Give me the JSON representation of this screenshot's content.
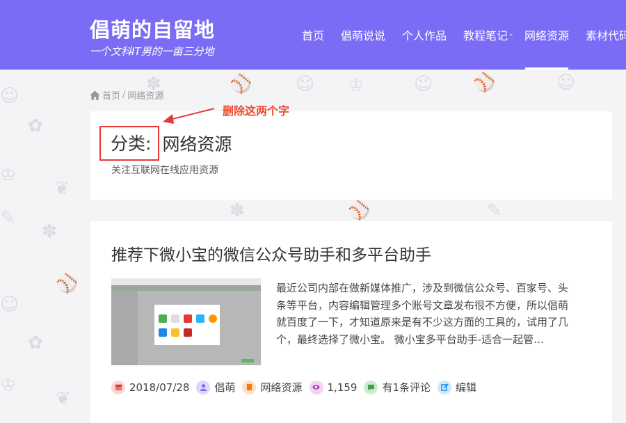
{
  "header": {
    "site_title": "倡萌的自留地",
    "site_subtitle": "一个文科IT男的一亩三分地",
    "background_color": "#7b6cf6"
  },
  "nav": {
    "items": [
      {
        "label": "首页"
      },
      {
        "label": "倡萌说说"
      },
      {
        "label": "个人作品"
      },
      {
        "label": "教程笔记",
        "has_dropdown": true
      },
      {
        "label": "网络资源",
        "active": true
      },
      {
        "label": "素材代码"
      }
    ]
  },
  "breadcrumb": {
    "home_label": "首页",
    "separator": "/",
    "current": "网络资源"
  },
  "annotation": {
    "text": "删除这两个字",
    "color": "#ef4a2c"
  },
  "category": {
    "prefix": "分类:",
    "name": "网络资源",
    "description": "关注互联网在线应用资源"
  },
  "article": {
    "title": "推荐下微小宝的微信公众号助手和多平台助手",
    "excerpt_lines": [
      "最近公司内部在做新媒体推广，涉及到微信公众号、百家号、头",
      "条等平台，内容编辑管理多个账号文章发布很不方便，所以倡萌",
      "就百度了一下，才知道原来是有不少这方面的工具的，试用了几",
      "个，最终选择了微小宝。 微小宝多平台助手-适合一起管…"
    ],
    "meta": {
      "date": "2018/07/28",
      "author": "倡萌",
      "category": "网络资源",
      "views": "1,159",
      "comments": "有1条评论",
      "edit": "编辑"
    }
  },
  "icons": {
    "calendar": "calendar-icon",
    "author": "user-icon",
    "category": "folder-icon",
    "views": "eye-icon",
    "comments": "comment-icon",
    "edit": "edit-icon"
  }
}
